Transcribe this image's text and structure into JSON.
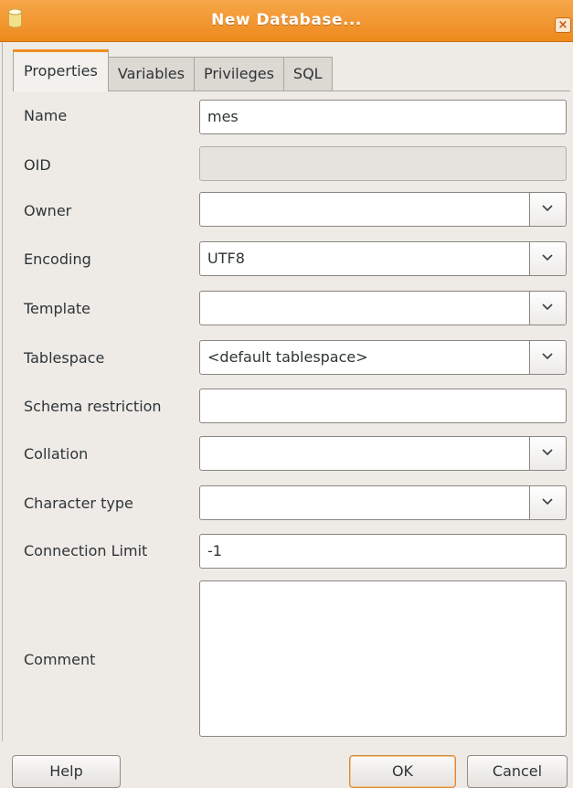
{
  "window": {
    "title": "New Database...",
    "close_glyph": "×"
  },
  "tabs": [
    {
      "label": "Properties",
      "active": true
    },
    {
      "label": "Variables",
      "active": false
    },
    {
      "label": "Privileges",
      "active": false
    },
    {
      "label": "SQL",
      "active": false
    }
  ],
  "form": {
    "name": {
      "label": "Name",
      "value": "mes"
    },
    "oid": {
      "label": "OID",
      "value": ""
    },
    "owner": {
      "label": "Owner",
      "value": ""
    },
    "encoding": {
      "label": "Encoding",
      "value": "UTF8"
    },
    "template": {
      "label": "Template",
      "value": ""
    },
    "tablespace": {
      "label": "Tablespace",
      "value": "<default tablespace>"
    },
    "schema_restriction": {
      "label": "Schema restriction",
      "value": ""
    },
    "collation": {
      "label": "Collation",
      "value": ""
    },
    "character_type": {
      "label": "Character type",
      "value": ""
    },
    "connection_limit": {
      "label": "Connection Limit",
      "value": "-1"
    },
    "comment": {
      "label": "Comment",
      "value": ""
    }
  },
  "buttons": {
    "help": "Help",
    "ok": "OK",
    "cancel": "Cancel"
  },
  "icons": {
    "app": "database-icon",
    "close": "close-icon",
    "dropdown": "chevron-down-icon"
  },
  "colors": {
    "titlebar": "#ee8a1c",
    "active_tab_accent": "#f08f20",
    "background": "#eeebe7"
  }
}
